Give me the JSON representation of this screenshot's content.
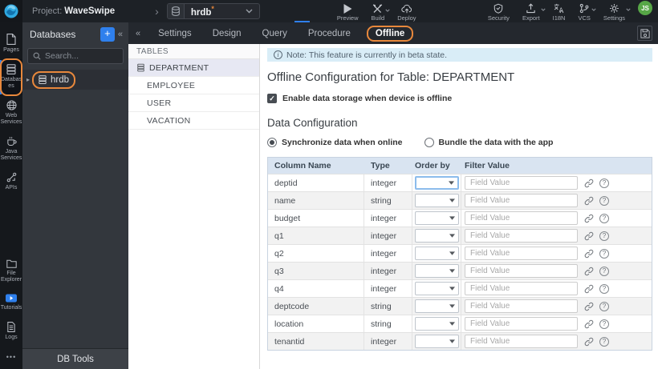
{
  "colors": {
    "accent_blue": "#2f80ed",
    "annotation_orange": "#e8883c",
    "topbar_bg": "#1d2126",
    "panel_bg": "#33373d",
    "note_bg": "#d9edf7",
    "grid_header_bg": "#d9e4f1",
    "selected_row_bg": "#e7e8f3",
    "avatar_green": "#57a747",
    "logo_blue": "#2fa9e1"
  },
  "glyphs": {
    "collapse_left": "«",
    "plus": "+",
    "expander": "▸",
    "more": "•••",
    "help": "?",
    "info": "i",
    "chevron_right": "›",
    "modified_asterisk": "*",
    "check": "✓"
  },
  "topbar": {
    "project_label": "Project:",
    "project_name": "WaveSwipe",
    "database_selector": {
      "name": "hrdb"
    },
    "actions": {
      "preview": "Preview",
      "build": "Build",
      "deploy": "Deploy"
    },
    "right_actions": {
      "security": "Security",
      "export": "Export",
      "i18n": "I18N",
      "vcs": "VCS",
      "settings": "Settings"
    },
    "avatar_initials": "JS"
  },
  "activity_bar": {
    "items": [
      {
        "label": "Pages"
      },
      {
        "label": "Databases",
        "active": true
      },
      {
        "label": "Web Services"
      },
      {
        "label": "Java Services"
      },
      {
        "label": "APIs"
      },
      {
        "label": "File Explorer"
      },
      {
        "label": "Tutorials"
      },
      {
        "label": "Logs"
      }
    ]
  },
  "db_panel": {
    "title": "Databases",
    "search_placeholder": "Search...",
    "items": [
      {
        "label": "hrdb"
      }
    ],
    "footer_label": "DB Tools"
  },
  "tabs": {
    "items": [
      "Settings",
      "Design",
      "Query",
      "Procedure",
      "Offline"
    ],
    "active_tab": "Offline"
  },
  "tables_panel": {
    "title": "TABLES",
    "items": [
      {
        "label": "DEPARTMENT",
        "selected": true
      },
      {
        "label": "EMPLOYEE"
      },
      {
        "label": "USER"
      },
      {
        "label": "VACATION"
      }
    ]
  },
  "offline": {
    "note": "Note: This feature is currently in beta state.",
    "title": "Offline Configuration for Table: DEPARTMENT",
    "enable_label": "Enable data storage when device is offline",
    "enable_checked": true,
    "section_title": "Data Configuration",
    "radio_options": [
      {
        "label": "Synchronize data when online",
        "selected": true
      },
      {
        "label": "Bundle the data with the app",
        "selected": false
      }
    ],
    "grid": {
      "headers": [
        "Column Name",
        "Type",
        "Order by",
        "Filter Value"
      ],
      "filter_placeholder": "Field Value",
      "rows": [
        {
          "column_name": "deptid",
          "type": "integer"
        },
        {
          "column_name": "name",
          "type": "string"
        },
        {
          "column_name": "budget",
          "type": "integer"
        },
        {
          "column_name": "q1",
          "type": "integer"
        },
        {
          "column_name": "q2",
          "type": "integer"
        },
        {
          "column_name": "q3",
          "type": "integer"
        },
        {
          "column_name": "q4",
          "type": "integer"
        },
        {
          "column_name": "deptcode",
          "type": "string"
        },
        {
          "column_name": "location",
          "type": "string"
        },
        {
          "column_name": "tenantid",
          "type": "integer"
        }
      ]
    }
  }
}
